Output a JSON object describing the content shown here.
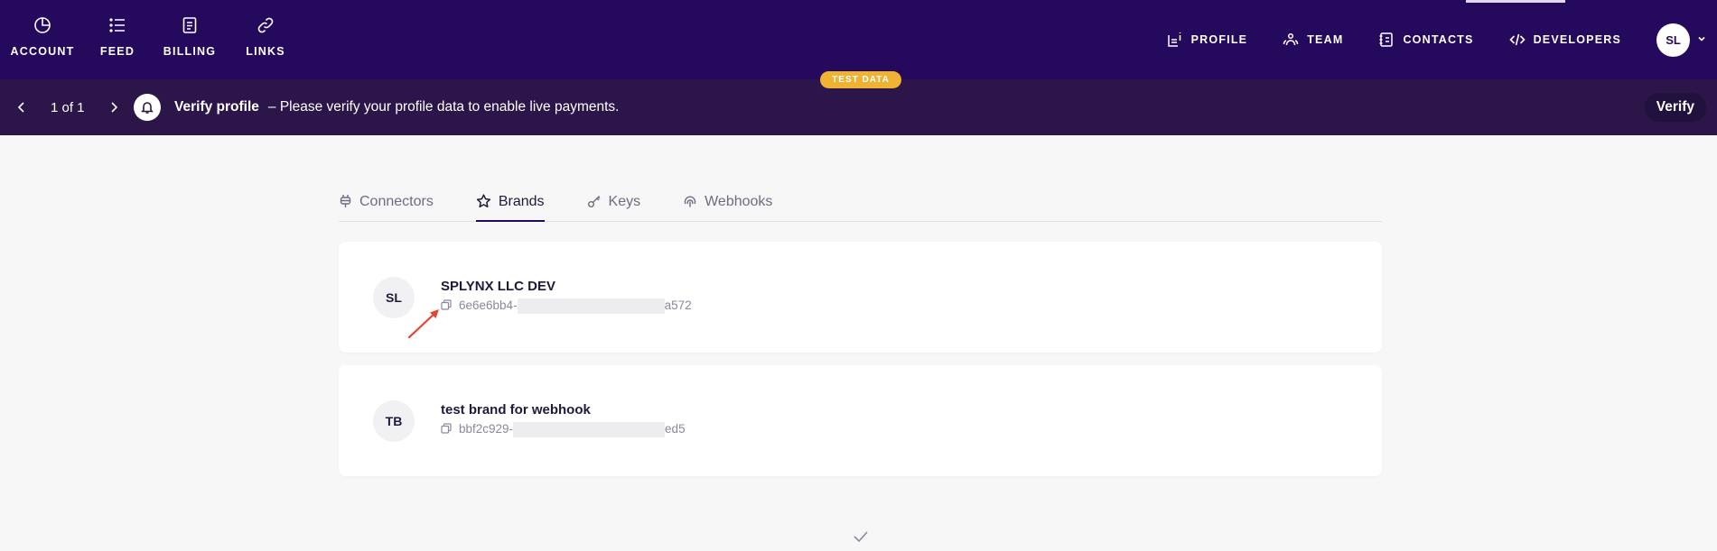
{
  "top_nav": {
    "left_items": [
      {
        "label": "ACCOUNT",
        "icon": "pie-chart-icon"
      },
      {
        "label": "FEED",
        "icon": "list-icon"
      },
      {
        "label": "BILLING",
        "icon": "document-icon"
      },
      {
        "label": "LINKS",
        "icon": "link-icon"
      }
    ],
    "right_items": [
      {
        "label": "PROFILE",
        "icon": "profile-info-icon"
      },
      {
        "label": "TEAM",
        "icon": "team-icon"
      },
      {
        "label": "CONTACTS",
        "icon": "contacts-icon"
      },
      {
        "label": "DEVELOPERS",
        "icon": "code-icon"
      }
    ],
    "user_initials": "SL"
  },
  "banner": {
    "badge": "TEST DATA",
    "pager": "1 of 1",
    "title": "Verify profile",
    "message": "–  Please verify your profile data to enable live payments.",
    "action": "Verify"
  },
  "tabs": [
    {
      "label": "Connectors",
      "icon": "plug-icon",
      "active": false
    },
    {
      "label": "Brands",
      "icon": "star-icon",
      "active": true
    },
    {
      "label": "Keys",
      "icon": "key-icon",
      "active": false
    },
    {
      "label": "Webhooks",
      "icon": "webhook-icon",
      "active": false
    }
  ],
  "brands": [
    {
      "initials": "SL",
      "name": "SPLYNX LLC DEV",
      "id_prefix": "6e6e6bb4-",
      "id_suffix": "a572"
    },
    {
      "initials": "TB",
      "name": "test brand for webhook",
      "id_prefix": "bbf2c929-",
      "id_suffix": "ed5"
    }
  ],
  "colors": {
    "nav_bg": "#25095c",
    "banner_bg": "#2b1549",
    "badge": "#f0b232",
    "annotation_arrow": "#e8432f"
  }
}
